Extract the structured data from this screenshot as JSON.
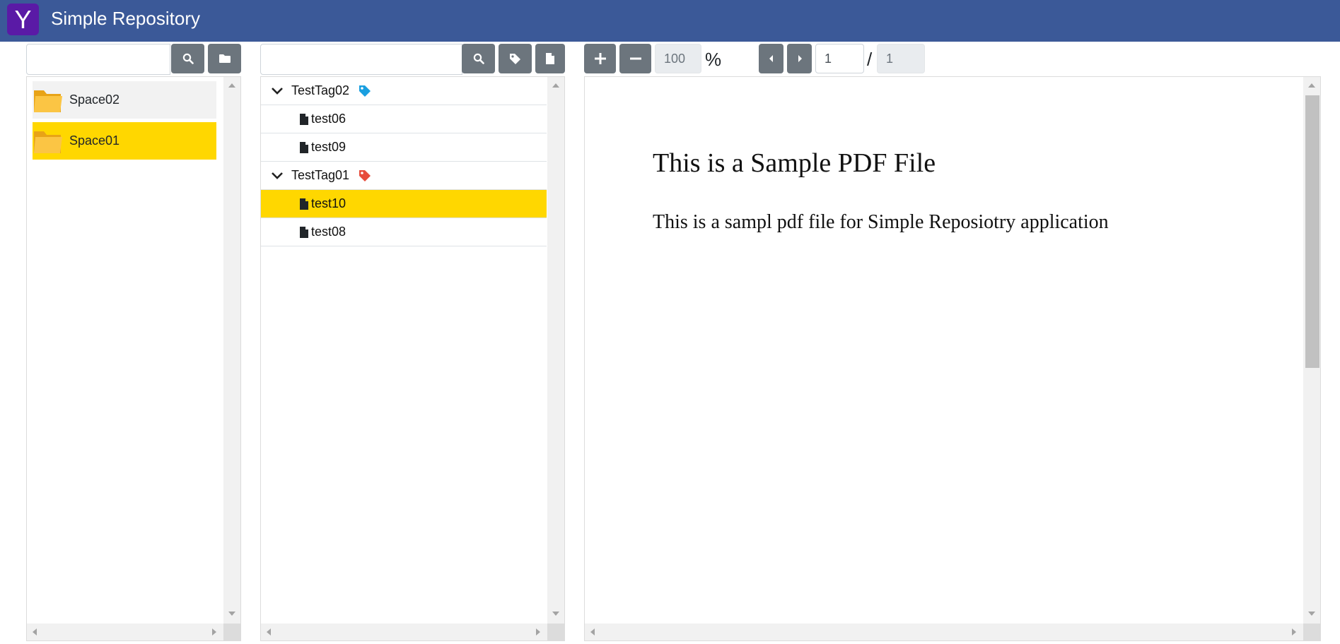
{
  "app": {
    "logo_letter": "Y",
    "title": "Simple Repository"
  },
  "spaces_panel": {
    "search": {
      "value": "",
      "placeholder": ""
    },
    "items": [
      {
        "label": "Space02",
        "selected": false
      },
      {
        "label": "Space01",
        "selected": true
      }
    ]
  },
  "tags_panel": {
    "search": {
      "value": "",
      "placeholder": ""
    },
    "groups": [
      {
        "label": "TestTag02",
        "tag_color": "#1a9fe0",
        "expanded": true,
        "files": [
          {
            "label": "test06",
            "selected": false
          },
          {
            "label": "test09",
            "selected": false
          }
        ]
      },
      {
        "label": "TestTag01",
        "tag_color": "#e74c3c",
        "expanded": true,
        "files": [
          {
            "label": "test10",
            "selected": true
          },
          {
            "label": "test08",
            "selected": false
          }
        ]
      }
    ]
  },
  "viewer": {
    "zoom": "100",
    "zoom_unit": "%",
    "page_current": "1",
    "page_separator": "/",
    "page_total": "1",
    "document": {
      "heading": "This is a Sample PDF File",
      "body": "This is a sampl pdf file for Simple Reposiotry application"
    }
  },
  "colors": {
    "header": "#3b5998",
    "logo_bg": "#5a1aa6",
    "selection": "#ffd700",
    "button": "#6c757d"
  }
}
